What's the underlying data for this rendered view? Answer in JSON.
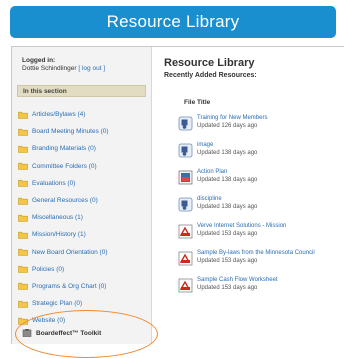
{
  "header": {
    "title": "Resource Library"
  },
  "sidebar": {
    "logged_in_label": "Logged in:",
    "user_name": "Dottie Schindlinger",
    "logout_label": "[ log out ]",
    "section_title": "In this section",
    "items": [
      {
        "label": "Articles/Bylaws (4)"
      },
      {
        "label": "Board Meeting Minutes (0)"
      },
      {
        "label": "Branding Materials (0)"
      },
      {
        "label": "Committee Folders (0)"
      },
      {
        "label": "Evaluations (0)"
      },
      {
        "label": "General Resources (0)"
      },
      {
        "label": "Miscellaneous (1)"
      },
      {
        "label": "Mission/History (1)"
      },
      {
        "label": "New Board Orientation (0)"
      },
      {
        "label": "Policies (0)"
      },
      {
        "label": "Programs & Org Chart (0)"
      },
      {
        "label": "Strategic Plan (0)"
      },
      {
        "label": "Website (0)"
      }
    ],
    "toolkit_label": "Boardeffect™ Toolkit"
  },
  "main": {
    "title": "Resource Library",
    "subtitle": "Recently Added Resources:",
    "column_header": "File Title",
    "resources": [
      {
        "title": "Training for New Members",
        "updated": "Updated 126 days ago",
        "icon": "video-file-icon"
      },
      {
        "title": "image",
        "updated": "Updated 138 days ago",
        "icon": "video-file-icon"
      },
      {
        "title": "Action Plan",
        "updated": "Updated 138 days ago",
        "icon": "image-file-icon"
      },
      {
        "title": "discipline",
        "updated": "Updated 138 days ago",
        "icon": "video-file-icon"
      },
      {
        "title": "Verve Internet Solutions - Mission",
        "updated": "Updated 153 days ago",
        "icon": "pdf-file-icon"
      },
      {
        "title": "Sample By-laws from the Minnesota Council",
        "updated": "Updated 153 days ago",
        "icon": "pdf-file-icon"
      },
      {
        "title": "Sample Cash Flow Worksheet",
        "updated": "Updated 153 days ago",
        "icon": "pdf-file-icon"
      }
    ]
  },
  "colors": {
    "header_bg": "#1a8fd0",
    "link": "#2a6db4",
    "highlight_ring": "#ef8a33"
  }
}
